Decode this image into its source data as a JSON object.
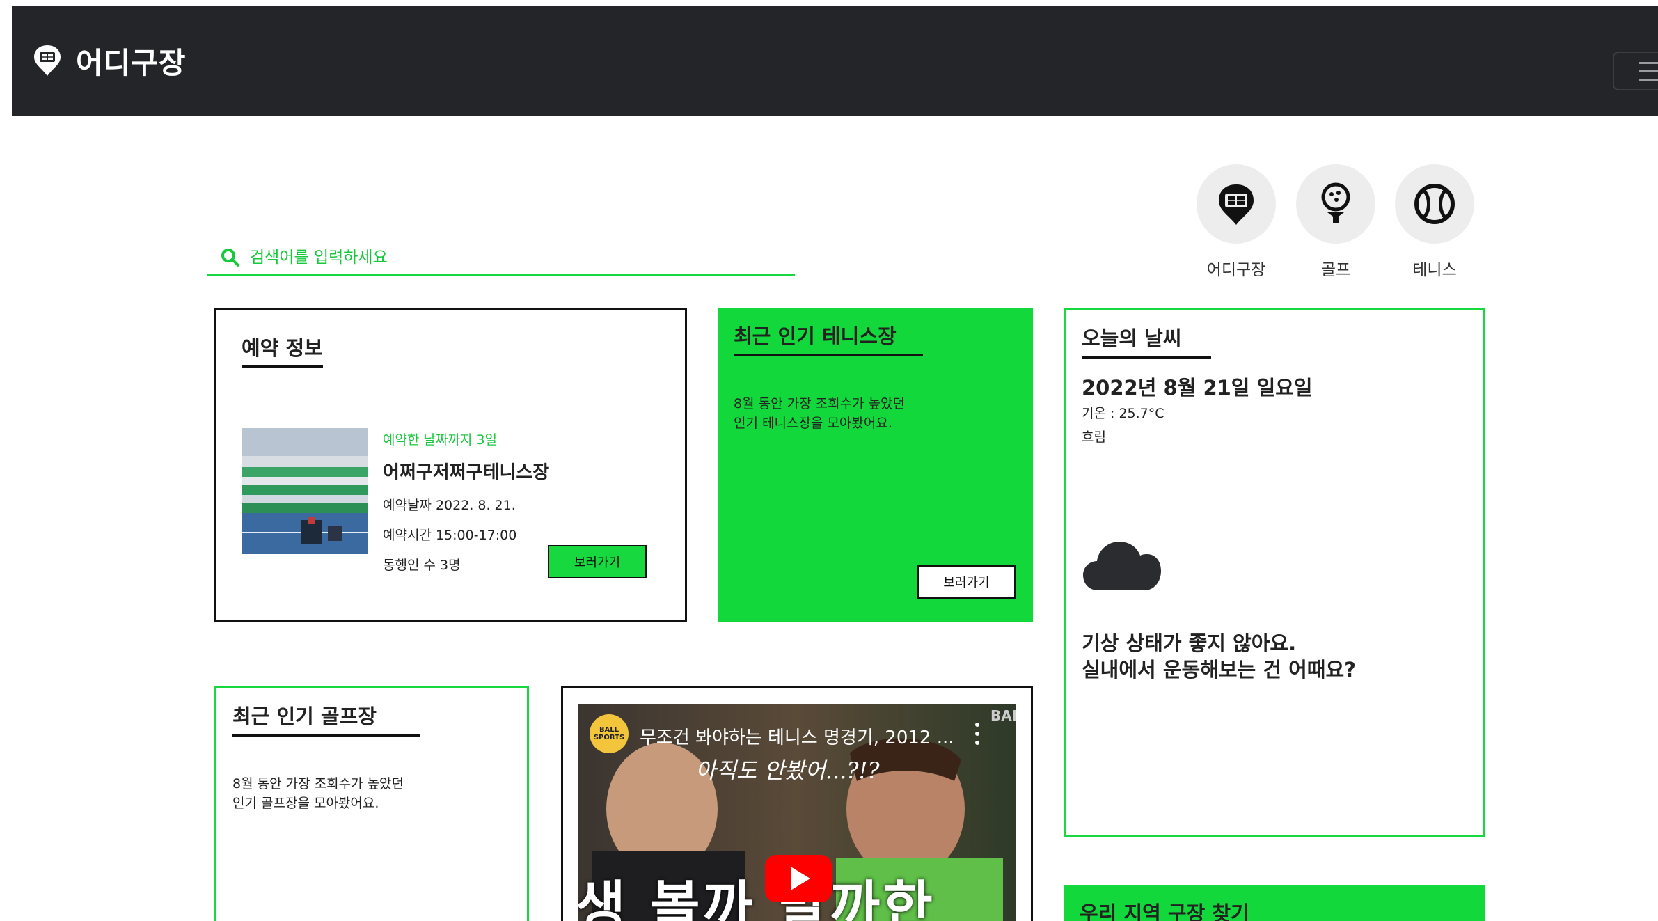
{
  "header": {
    "brand": "어디구장",
    "brand_icon": "stadium-pin-icon",
    "menu_icon": "hamburger-icon"
  },
  "search": {
    "placeholder": "검색어를 입력하세요",
    "icon": "search-icon",
    "accent": "#18d840"
  },
  "categories": [
    {
      "label": "어디구장",
      "icon": "stadium-pin-icon"
    },
    {
      "label": "골프",
      "icon": "golf-ball-tee-icon"
    },
    {
      "label": "테니스",
      "icon": "tennis-ball-icon"
    }
  ],
  "reservation": {
    "title": "예약 정보",
    "dday": "예약한 날짜까지 3일",
    "venue": "어쩌구저쩌구테니스장",
    "date": "예약날짜 2022. 8. 21.",
    "time": "예약시간 15:00-17:00",
    "companions": "동행인 수 3명",
    "button": "보러가기"
  },
  "tennis": {
    "title": "최근 인기 테니스장",
    "desc_line1": "8월 동안 가장 조회수가 높았던",
    "desc_line2": "인기 테니스장을 모아봤어요.",
    "button": "보러가기",
    "bg": "#13d83b"
  },
  "weather": {
    "title": "오늘의 날씨",
    "date": "2022년 8월 21일 일요일",
    "temp": "기온 : 25.7°C",
    "condition": "흐림",
    "icon": "cloud-icon",
    "msg_line1": "기상 상태가 좋지 않아요.",
    "msg_line2": "실내에서 운동해보는 건 어때요?"
  },
  "golf": {
    "title": "최근 인기 골프장",
    "desc_line1": "8월 동안 가장 조회수가 높았던",
    "desc_line2": "인기 골프장을 모아봤어요."
  },
  "video": {
    "channel": "BALL SPORTS",
    "title": "무조건 봐야하는 테니스 명경기, 2012 ...",
    "subtitle": "아직도 안봤어...?!?",
    "overlay_text": "생 볼까 말까한",
    "corner": "BAI"
  },
  "region": {
    "title": "우리 지역 구장 찾기"
  }
}
